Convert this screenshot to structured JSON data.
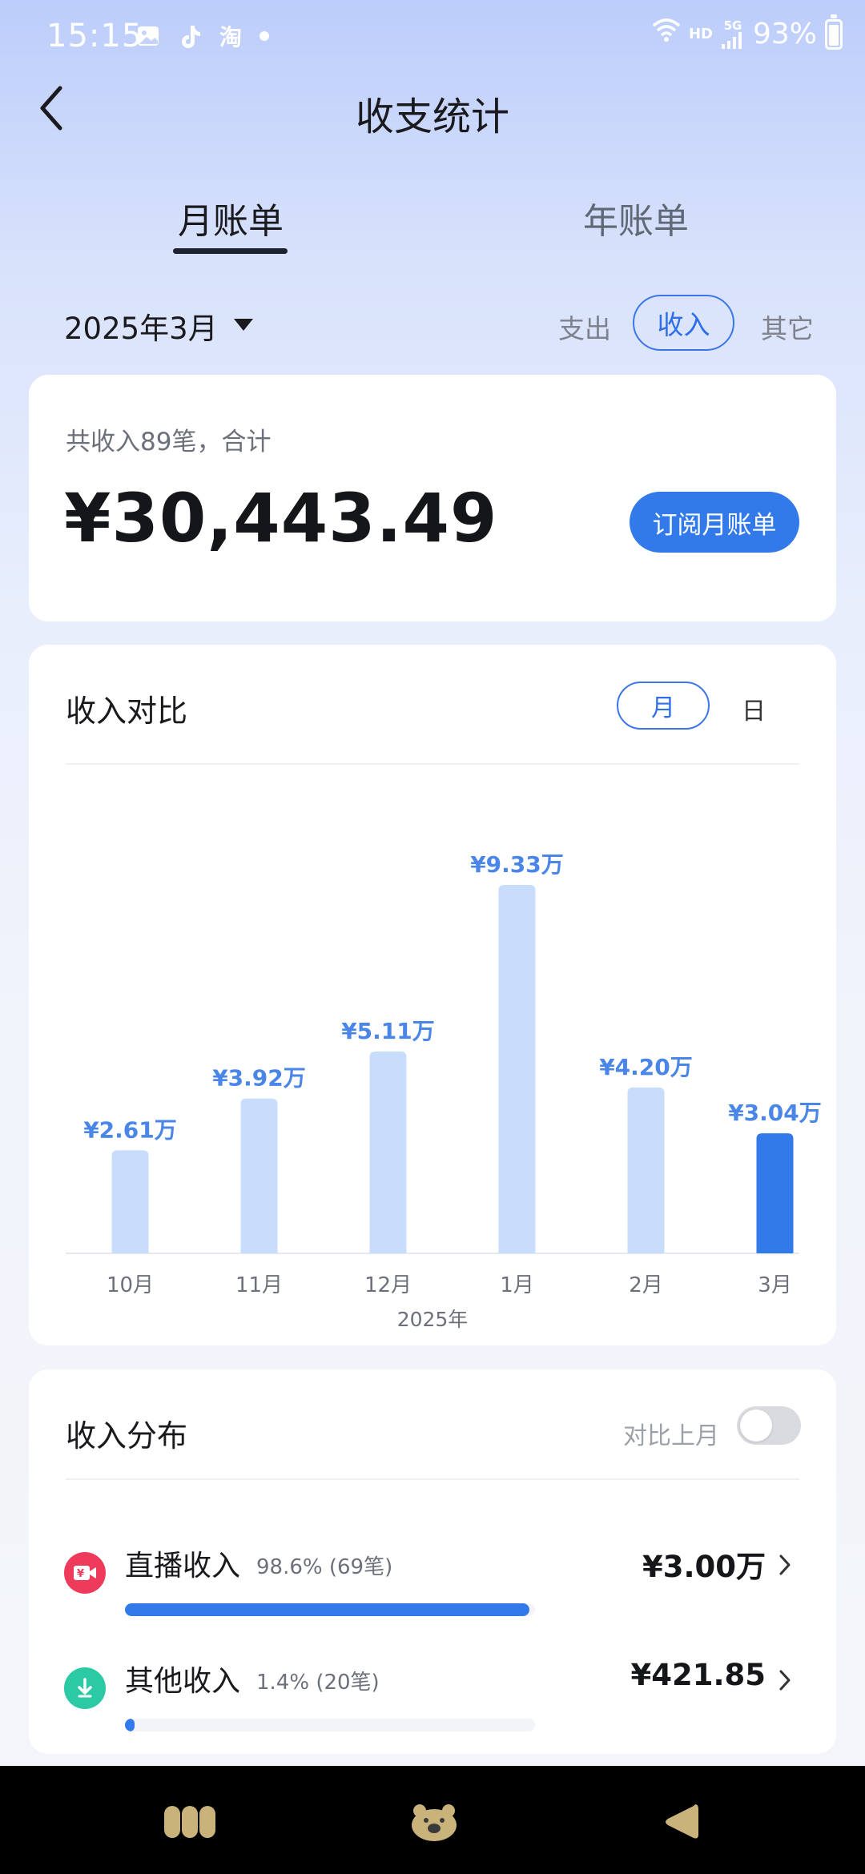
{
  "status_bar": {
    "time": "15:15",
    "network_hd": "HD",
    "network_5g": "5G",
    "battery": "93%"
  },
  "header": {
    "title": "收支统计",
    "tabs": [
      {
        "label": "月账单",
        "active": true
      },
      {
        "label": "年账单",
        "active": false
      }
    ]
  },
  "filters": {
    "month": "2025年3月",
    "options": [
      {
        "label": "支出",
        "active": false
      },
      {
        "label": "收入",
        "active": true
      },
      {
        "label": "其它",
        "active": false
      }
    ]
  },
  "summary": {
    "caption": "共收入89笔，合计",
    "amount": "¥30,443.49",
    "subscribe_label": "订阅月账单"
  },
  "compare": {
    "title": "收入对比",
    "segments": {
      "month": "月",
      "day": "日"
    },
    "year_label": "2025年"
  },
  "chart_data": {
    "type": "bar",
    "categories": [
      "10月",
      "11月",
      "12月",
      "1月",
      "2月",
      "3月"
    ],
    "values": [
      2.61,
      3.92,
      5.11,
      9.33,
      4.2,
      3.04
    ],
    "value_labels": [
      "¥2.61万",
      "¥3.92万",
      "¥5.11万",
      "¥9.33万",
      "¥4.20万",
      "¥3.04万"
    ],
    "highlight_index": 5,
    "ylim": [
      0,
      10
    ],
    "colors": {
      "normal": "#c8dcfb",
      "highlight": "#3279ea",
      "label": "#4a86e8"
    }
  },
  "distribution": {
    "title": "收入分布",
    "compare_toggle_label": "对比上月",
    "compare_toggle_on": false,
    "items": [
      {
        "name": "直播收入",
        "meta": "98.6% (69笔)",
        "amount": "¥3.00万",
        "share": 0.986,
        "icon": "live-camera-icon",
        "color": "#ee3a5b"
      },
      {
        "name": "其他收入",
        "meta": "1.4% (20笔)",
        "amount": "¥421.85",
        "share": 0.014,
        "icon": "yen-download-icon",
        "color": "#2bc9a4"
      }
    ]
  }
}
